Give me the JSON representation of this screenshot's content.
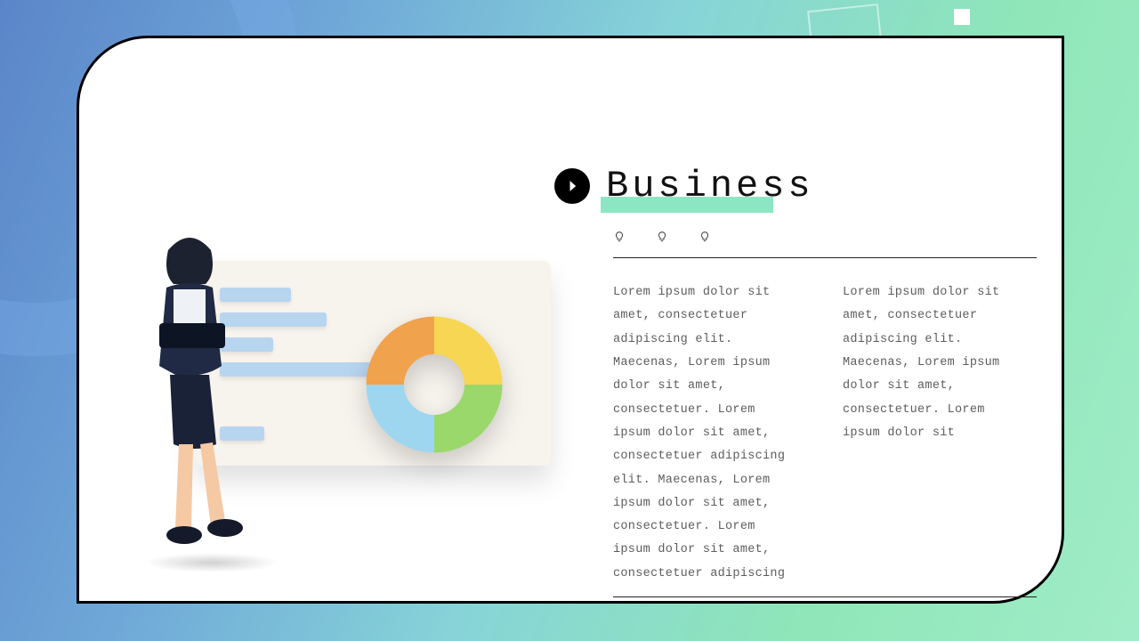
{
  "title": "Business",
  "columns": [
    "Lorem ipsum dolor sit amet, consectetuer adipiscing elit. Maecenas, Lorem ipsum dolor sit amet, consectetuer. Lorem ipsum dolor sit amet, consectetuer adipiscing elit. Maecenas, Lorem ipsum dolor sit amet, consectetuer. Lorem ipsum dolor sit amet, consectetuer adipiscing",
    "Lorem ipsum dolor sit amet, consectetuer adipiscing elit. Maecenas, Lorem ipsum dolor sit amet, consectetuer. Lorem ipsum dolor sit"
  ],
  "chart_data": {
    "type": "pie",
    "title": "",
    "series": [
      {
        "name": "slice-yellow",
        "value": 25,
        "color": "#f6d653"
      },
      {
        "name": "slice-green",
        "value": 25,
        "color": "#9ad86b"
      },
      {
        "name": "slice-blue",
        "value": 25,
        "color": "#9fd6ef"
      },
      {
        "name": "slice-orange",
        "value": 25,
        "color": "#f1a24d"
      }
    ],
    "donut": true
  },
  "illustration_bars": [
    80,
    120,
    60,
    180,
    50
  ]
}
